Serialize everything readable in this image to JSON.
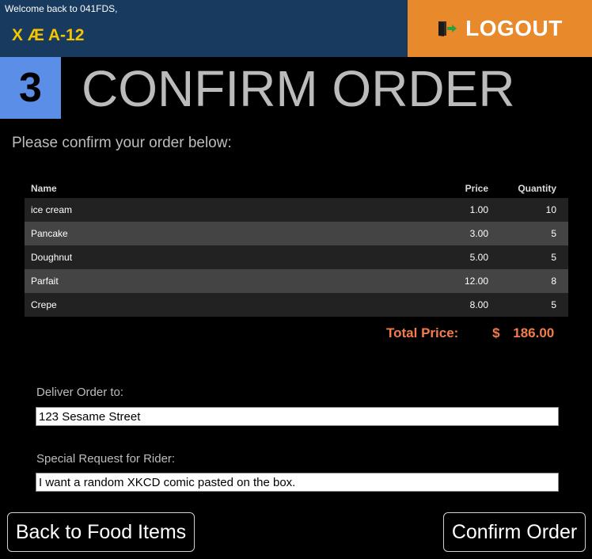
{
  "header": {
    "welcome_text": "Welcome back to 041FDS,",
    "username": "X Æ A-12",
    "logout_label": "LOGOUT"
  },
  "step": {
    "number": "3",
    "title": "CONFIRM ORDER"
  },
  "instruction": "Please confirm your order below:",
  "table": {
    "columns": {
      "name": "Name",
      "price": "Price",
      "quantity": "Quantity"
    },
    "rows": [
      {
        "name": "ice cream",
        "price": "1.00",
        "quantity": "10"
      },
      {
        "name": "Pancake",
        "price": "3.00",
        "quantity": "5"
      },
      {
        "name": "Doughnut",
        "price": "5.00",
        "quantity": "5"
      },
      {
        "name": "Parfait",
        "price": "12.00",
        "quantity": "8"
      },
      {
        "name": "Crepe",
        "price": "8.00",
        "quantity": "5"
      }
    ]
  },
  "total": {
    "label": "Total Price:",
    "currency": "$",
    "value": "186.00"
  },
  "delivery": {
    "label": "Deliver Order to:",
    "value": "123 Sesame Street"
  },
  "special_request": {
    "label": "Special Request for Rider:",
    "value": "I want a random XKCD comic pasted on the box."
  },
  "buttons": {
    "back_label": "Back to Food Items",
    "confirm_label": "Confirm Order"
  },
  "colors": {
    "header_bg": "#173a5e",
    "username": "#f5c400",
    "logout_bg": "#e8892b",
    "step_box": "#5b8ee6",
    "total_text": "#f47c4b"
  }
}
